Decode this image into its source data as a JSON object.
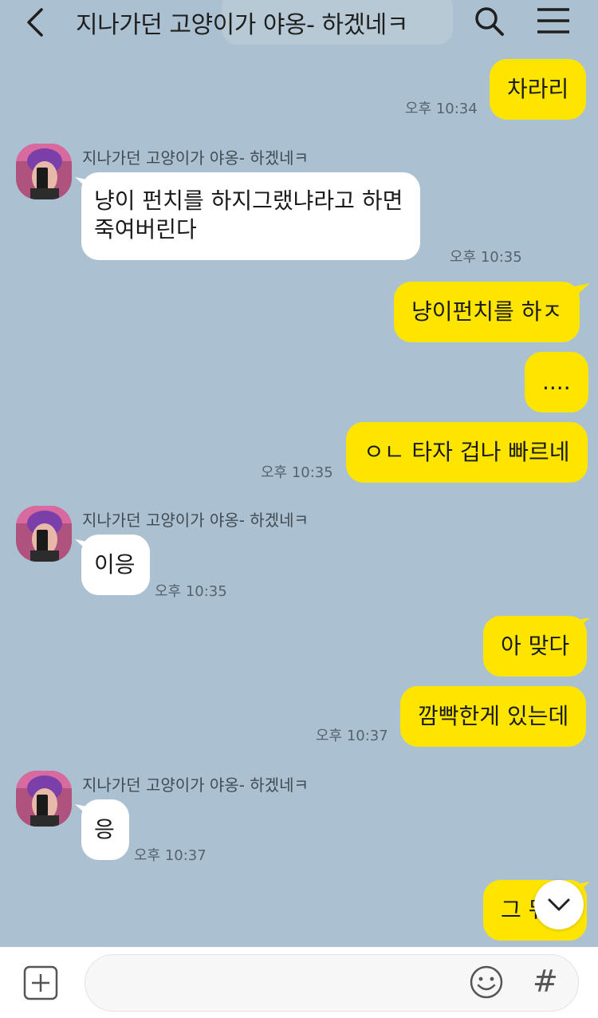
{
  "header": {
    "title": "지나가던 고양이가 야옹- 하겠네ㅋ",
    "back_icon": "chevron-left-icon",
    "search_icon": "search-icon",
    "menu_icon": "hamburger-menu-icon"
  },
  "colors": {
    "background": "#abc1d1",
    "my_bubble": "#fee500",
    "other_bubble": "#ffffff"
  },
  "messages": [
    {
      "side": "me",
      "text": "차라리",
      "time": "오후 10:34"
    },
    {
      "side": "other",
      "sender": "지나가던 고양이가 야옹- 하겠네ㅋ",
      "lines": [
        "냥이 펀치를 하지그랬냐라고 하면",
        "죽여버린다"
      ],
      "time": "오후 10:35"
    },
    {
      "side": "me",
      "text": "냥이펀치를  하ㅈ"
    },
    {
      "side": "me",
      "text": "...."
    },
    {
      "side": "me",
      "text": "ㅇㄴ 타자 겁나 빠르네",
      "time": "오후 10:35"
    },
    {
      "side": "other",
      "sender": "지나가던 고양이가 야옹- 하겠네ㅋ",
      "text": "이응",
      "time": "오후 10:35"
    },
    {
      "side": "me",
      "text": "아 맞다"
    },
    {
      "side": "me",
      "text": "깜빡한게 있는데",
      "time": "오후 10:37"
    },
    {
      "side": "other",
      "sender": "지나가던 고양이가 야옹- 하겠네ㅋ",
      "text": "응",
      "time": "오후 10:37"
    },
    {
      "side": "me",
      "text": "그 뭐냐"
    }
  ],
  "scroll_down_icon": "chevron-down-icon",
  "input_bar": {
    "add_icon": "plus-box-icon",
    "placeholder": "",
    "emoji_icon": "emoji-icon",
    "hashtag_label": "#"
  }
}
